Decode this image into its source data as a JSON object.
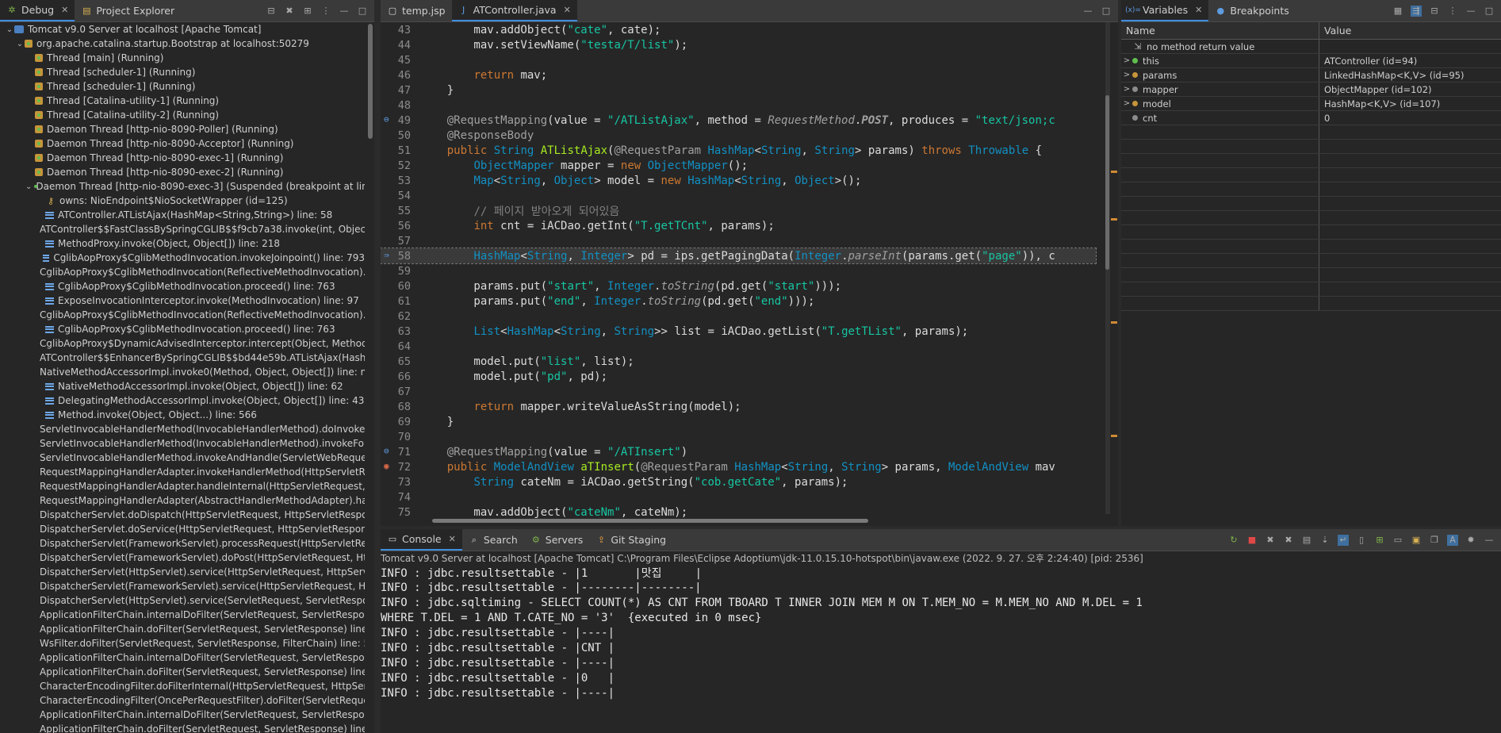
{
  "debug": {
    "tabs": [
      {
        "label": "Debug"
      },
      {
        "label": "Project Explorer"
      }
    ],
    "tree": [
      {
        "indent": 0,
        "tw": "⌄",
        "icon": "srv",
        "text": "Tomcat v9.0 Server at localhost [Apache Tomcat]"
      },
      {
        "indent": 1,
        "tw": "⌄",
        "icon": "thr",
        "text": "org.apache.catalina.startup.Bootstrap at localhost:50279"
      },
      {
        "indent": 2,
        "tw": "",
        "icon": "thr",
        "text": "Thread [main] (Running)"
      },
      {
        "indent": 2,
        "tw": "",
        "icon": "thr",
        "text": "Thread [scheduler-1] (Running)"
      },
      {
        "indent": 2,
        "tw": "",
        "icon": "thr",
        "text": "Thread [scheduler-1] (Running)"
      },
      {
        "indent": 2,
        "tw": "",
        "icon": "thr",
        "text": "Thread [Catalina-utility-1] (Running)"
      },
      {
        "indent": 2,
        "tw": "",
        "icon": "thr",
        "text": "Thread [Catalina-utility-2] (Running)"
      },
      {
        "indent": 2,
        "tw": "",
        "icon": "thr",
        "text": "Daemon Thread [http-nio-8090-Poller] (Running)"
      },
      {
        "indent": 2,
        "tw": "",
        "icon": "thr",
        "text": "Daemon Thread [http-nio-8090-Acceptor] (Running)"
      },
      {
        "indent": 2,
        "tw": "",
        "icon": "thr",
        "text": "Daemon Thread [http-nio-8090-exec-1] (Running)"
      },
      {
        "indent": 2,
        "tw": "",
        "icon": "thr",
        "text": "Daemon Thread [http-nio-8090-exec-2] (Running)"
      },
      {
        "indent": 2,
        "tw": "⌄",
        "icon": "thr",
        "text": "Daemon Thread [http-nio-8090-exec-3] (Suspended (breakpoint at line"
      },
      {
        "indent": 3,
        "tw": "",
        "icon": "key",
        "text": "owns: NioEndpoint$NioSocketWrapper  (id=125)"
      },
      {
        "indent": 3,
        "tw": "",
        "icon": "stk",
        "text": "ATController.ATListAjax(HashMap<String,String>) line: 58"
      },
      {
        "indent": 3,
        "tw": "",
        "icon": "stk",
        "text": "ATController$$FastClassBySpringCGLIB$$f9cb7a38.invoke(int, Object"
      },
      {
        "indent": 3,
        "tw": "",
        "icon": "stk",
        "text": "MethodProxy.invoke(Object, Object[]) line: 218"
      },
      {
        "indent": 3,
        "tw": "",
        "icon": "stk",
        "text": "CglibAopProxy$CglibMethodInvocation.invokeJoinpoint() line: 793"
      },
      {
        "indent": 3,
        "tw": "",
        "icon": "stk",
        "text": "CglibAopProxy$CglibMethodInvocation(ReflectiveMethodInvocation)."
      },
      {
        "indent": 3,
        "tw": "",
        "icon": "stk",
        "text": "CglibAopProxy$CglibMethodInvocation.proceed() line: 763"
      },
      {
        "indent": 3,
        "tw": "",
        "icon": "stk",
        "text": "ExposeInvocationInterceptor.invoke(MethodInvocation) line: 97"
      },
      {
        "indent": 3,
        "tw": "",
        "icon": "stk",
        "text": "CglibAopProxy$CglibMethodInvocation(ReflectiveMethodInvocation)."
      },
      {
        "indent": 3,
        "tw": "",
        "icon": "stk",
        "text": "CglibAopProxy$CglibMethodInvocation.proceed() line: 763"
      },
      {
        "indent": 3,
        "tw": "",
        "icon": "stk",
        "text": "CglibAopProxy$DynamicAdvisedInterceptor.intercept(Object, Method"
      },
      {
        "indent": 3,
        "tw": "",
        "icon": "stk",
        "text": "ATController$$EnhancerBySpringCGLIB$$bd44e59b.ATListAjax(HashM"
      },
      {
        "indent": 3,
        "tw": "",
        "icon": "stk",
        "text": "NativeMethodAccessorImpl.invoke0(Method, Object, Object[]) line: n"
      },
      {
        "indent": 3,
        "tw": "",
        "icon": "stk",
        "text": "NativeMethodAccessorImpl.invoke(Object, Object[]) line: 62"
      },
      {
        "indent": 3,
        "tw": "",
        "icon": "stk",
        "text": "DelegatingMethodAccessorImpl.invoke(Object, Object[]) line: 43"
      },
      {
        "indent": 3,
        "tw": "",
        "icon": "stk",
        "text": "Method.invoke(Object, Object...) line: 566"
      },
      {
        "indent": 3,
        "tw": "",
        "icon": "stk",
        "text": "ServletInvocableHandlerMethod(InvocableHandlerMethod).doInvoke("
      },
      {
        "indent": 3,
        "tw": "",
        "icon": "stk",
        "text": "ServletInvocableHandlerMethod(InvocableHandlerMethod).invokeForI"
      },
      {
        "indent": 3,
        "tw": "",
        "icon": "stk",
        "text": "ServletInvocableHandlerMethod.invokeAndHandle(ServletWebReques"
      },
      {
        "indent": 3,
        "tw": "",
        "icon": "stk",
        "text": "RequestMappingHandlerAdapter.invokeHandlerMethod(HttpServletRe"
      },
      {
        "indent": 3,
        "tw": "",
        "icon": "stk",
        "text": "RequestMappingHandlerAdapter.handleInternal(HttpServletRequest, H"
      },
      {
        "indent": 3,
        "tw": "",
        "icon": "stk",
        "text": "RequestMappingHandlerAdapter(AbstractHandlerMethodAdapter).har"
      },
      {
        "indent": 3,
        "tw": "",
        "icon": "stk",
        "text": "DispatcherServlet.doDispatch(HttpServletRequest, HttpServletRespon"
      },
      {
        "indent": 3,
        "tw": "",
        "icon": "stk",
        "text": "DispatcherServlet.doService(HttpServletRequest, HttpServletResponse"
      },
      {
        "indent": 3,
        "tw": "",
        "icon": "stk",
        "text": "DispatcherServlet(FrameworkServlet).processRequest(HttpServletRequ"
      },
      {
        "indent": 3,
        "tw": "",
        "icon": "stk",
        "text": "DispatcherServlet(FrameworkServlet).doPost(HttpServletRequest, Http"
      },
      {
        "indent": 3,
        "tw": "",
        "icon": "stk",
        "text": "DispatcherServlet(HttpServlet).service(HttpServletRequest, HttpServl"
      },
      {
        "indent": 3,
        "tw": "",
        "icon": "stk",
        "text": "DispatcherServlet(FrameworkServlet).service(HttpServletRequest, Http"
      },
      {
        "indent": 3,
        "tw": "",
        "icon": "stk",
        "text": "DispatcherServlet(HttpServlet).service(ServletRequest, ServletRespons"
      },
      {
        "indent": 3,
        "tw": "",
        "icon": "stk",
        "text": "ApplicationFilterChain.internalDoFilter(ServletRequest, ServletRespons"
      },
      {
        "indent": 3,
        "tw": "",
        "icon": "stk",
        "text": "ApplicationFilterChain.doFilter(ServletRequest, ServletResponse) line:"
      },
      {
        "indent": 3,
        "tw": "",
        "icon": "stk",
        "text": "WsFilter.doFilter(ServletRequest, ServletResponse, FilterChain) line: 53"
      },
      {
        "indent": 3,
        "tw": "",
        "icon": "stk",
        "text": "ApplicationFilterChain.internalDoFilter(ServletRequest, ServletRespons"
      },
      {
        "indent": 3,
        "tw": "",
        "icon": "stk",
        "text": "ApplicationFilterChain.doFilter(ServletRequest, ServletResponse) line:"
      },
      {
        "indent": 3,
        "tw": "",
        "icon": "stk",
        "text": "CharacterEncodingFilter.doFilterInternal(HttpServletRequest, HttpServl"
      },
      {
        "indent": 3,
        "tw": "",
        "icon": "stk",
        "text": "CharacterEncodingFilter(OncePerRequestFilter).doFilter(ServletReque"
      },
      {
        "indent": 3,
        "tw": "",
        "icon": "stk",
        "text": "ApplicationFilterChain.internalDoFilter(ServletRequest, ServletRespons"
      },
      {
        "indent": 3,
        "tw": "",
        "icon": "stk",
        "text": "ApplicationFilterChain.doFilter(ServletRequest, ServletResponse) line:"
      }
    ]
  },
  "editor": {
    "tabs": [
      {
        "label": "temp.jsp",
        "active": false
      },
      {
        "label": "ATController.java",
        "active": true
      }
    ],
    "lines": [
      {
        "n": "43",
        "html": "        mav.addObject(<span class=\"st\">\"cate\"</span>, cate);"
      },
      {
        "n": "44",
        "html": "        mav.setViewName(<span class=\"st\">\"testa/T/list\"</span>);"
      },
      {
        "n": "45",
        "html": ""
      },
      {
        "n": "46",
        "html": "        <span class=\"kw\">return</span> mav;"
      },
      {
        "n": "47",
        "html": "    }"
      },
      {
        "n": "48",
        "html": ""
      },
      {
        "n": "49",
        "mark": "⊖",
        "html": "    <span class=\"an\">@RequestMapping</span>(value = <span class=\"st\">\"/ATListAjax\"</span>, method = <span class=\"it\">RequestMethod</span>.<span class=\"it\"><b>POST</b></span>, produces = <span class=\"st\">\"text/json;c</span>"
      },
      {
        "n": "50",
        "html": "    <span class=\"an\">@ResponseBody</span>"
      },
      {
        "n": "51",
        "html": "    <span class=\"kw\">public</span> <span class=\"ty\">String</span> <span class=\"fn\">ATListAjax</span>(<span class=\"an\">@RequestParam</span> <span class=\"ty\">HashMap</span>&lt;<span class=\"ty\">String</span>, <span class=\"ty\">String</span>&gt; params) <span class=\"kw\">throws</span> <span class=\"ty\">Throwable</span> {"
      },
      {
        "n": "52",
        "html": "        <span class=\"ty\">ObjectMapper</span> mapper = <span class=\"kw\">new</span> <span class=\"ty\">ObjectMapper</span>();"
      },
      {
        "n": "53",
        "html": "        <span class=\"ty\">Map</span>&lt;<span class=\"ty\">String</span>, <span class=\"ty\">Object</span>&gt; model = <span class=\"kw\">new</span> <span class=\"ty\">HashMap</span>&lt;<span class=\"ty\">String</span>, <span class=\"ty\">Object</span>&gt;();"
      },
      {
        "n": "54",
        "html": ""
      },
      {
        "n": "55",
        "html": "        <span class=\"cm\">// 페이지 받아오게 되어있음</span>"
      },
      {
        "n": "56",
        "html": "        <span class=\"kw\">int</span> cnt = iACDao.getInt(<span class=\"st\">\"T.getTCnt\"</span>, params);"
      },
      {
        "n": "57",
        "html": ""
      },
      {
        "n": "58",
        "mark": "⇛",
        "hl": true,
        "html": "        <span class=\"ty\">HashMap</span>&lt;<span class=\"ty\">String</span>, <span class=\"ty\">Integer</span>&gt; pd = ips.getPagingData(<span class=\"ty\">Integer</span>.<span class=\"it\">parseInt</span>(params.get(<span class=\"st\">\"page\"</span>)), c"
      },
      {
        "n": "59",
        "html": ""
      },
      {
        "n": "60",
        "html": "        params.put(<span class=\"st\">\"start\"</span>, <span class=\"ty\">Integer</span>.<span class=\"it\">toString</span>(pd.get(<span class=\"st\">\"start\"</span>)));"
      },
      {
        "n": "61",
        "html": "        params.put(<span class=\"st\">\"end\"</span>, <span class=\"ty\">Integer</span>.<span class=\"it\">toString</span>(pd.get(<span class=\"st\">\"end\"</span>)));"
      },
      {
        "n": "62",
        "html": ""
      },
      {
        "n": "63",
        "html": "        <span class=\"ty\">List</span>&lt;<span class=\"ty\">HashMap</span>&lt;<span class=\"ty\">String</span>, <span class=\"ty\">String</span>&gt;&gt; list = iACDao.getList(<span class=\"st\">\"T.getTList\"</span>, params);"
      },
      {
        "n": "64",
        "html": ""
      },
      {
        "n": "65",
        "html": "        model.put(<span class=\"st\">\"list\"</span>, list);"
      },
      {
        "n": "66",
        "html": "        model.put(<span class=\"st\">\"pd\"</span>, pd);"
      },
      {
        "n": "67",
        "html": ""
      },
      {
        "n": "68",
        "html": "        <span class=\"kw\">return</span> mapper.writeValueAsString(model);"
      },
      {
        "n": "69",
        "html": "    }"
      },
      {
        "n": "70",
        "html": ""
      },
      {
        "n": "71",
        "mark": "⊖",
        "html": "    <span class=\"an\">@RequestMapping</span>(value = <span class=\"st\">\"/ATInsert\"</span>)"
      },
      {
        "n": "72",
        "mark": "◉",
        "br": true,
        "html": "    <span class=\"kw\">public</span> <span class=\"ty\">ModelAndView</span> <span class=\"fn\">aTInsert</span>(<span class=\"an\">@RequestParam</span> <span class=\"ty\">HashMap</span>&lt;<span class=\"ty\">String</span>, <span class=\"ty\">String</span>&gt; params, <span class=\"ty\">ModelAndView</span> mav"
      },
      {
        "n": "73",
        "html": "        <span class=\"ty\">String</span> cateNm = iACDao.getString(<span class=\"st\">\"cob.getCate\"</span>, params);"
      },
      {
        "n": "74",
        "html": ""
      },
      {
        "n": "75",
        "html": "        mav.addObject(<span class=\"st\">\"cateNm\"</span>, cateNm);"
      }
    ]
  },
  "vars": {
    "tabs": [
      {
        "label": "Variables"
      },
      {
        "label": "Breakpoints"
      }
    ],
    "headers": {
      "name": "Name",
      "value": "Value"
    },
    "rows": [
      {
        "tw": "",
        "icon": "ret",
        "name": "no method return value",
        "value": ""
      },
      {
        "tw": ">",
        "icon": "g",
        "name": "this",
        "value": "ATController  (id=94)"
      },
      {
        "tw": ">",
        "icon": "p",
        "name": "params",
        "value": "LinkedHashMap<K,V>  (id=95)"
      },
      {
        "tw": ">",
        "icon": "l",
        "name": "mapper",
        "value": "ObjectMapper  (id=102)"
      },
      {
        "tw": ">",
        "icon": "p",
        "name": "model",
        "value": "HashMap<K,V>  (id=107)"
      },
      {
        "tw": "",
        "icon": "l",
        "name": "cnt",
        "value": "0"
      },
      {
        "tw": "",
        "icon": "",
        "name": "",
        "value": ""
      },
      {
        "tw": "",
        "icon": "",
        "name": "",
        "value": ""
      },
      {
        "tw": "",
        "icon": "",
        "name": "",
        "value": ""
      },
      {
        "tw": "",
        "icon": "",
        "name": "",
        "value": ""
      },
      {
        "tw": "",
        "icon": "",
        "name": "",
        "value": ""
      },
      {
        "tw": "",
        "icon": "",
        "name": "",
        "value": ""
      },
      {
        "tw": "",
        "icon": "",
        "name": "",
        "value": ""
      },
      {
        "tw": "",
        "icon": "",
        "name": "",
        "value": ""
      },
      {
        "tw": "",
        "icon": "",
        "name": "",
        "value": ""
      },
      {
        "tw": "",
        "icon": "",
        "name": "",
        "value": ""
      },
      {
        "tw": "",
        "icon": "",
        "name": "",
        "value": ""
      },
      {
        "tw": "",
        "icon": "",
        "name": "",
        "value": ""
      },
      {
        "tw": "",
        "icon": "",
        "name": "",
        "value": ""
      }
    ]
  },
  "console": {
    "tabs": [
      {
        "label": "Console",
        "active": true
      },
      {
        "label": "Search",
        "active": false
      },
      {
        "label": "Servers",
        "active": false
      },
      {
        "label": "Git Staging",
        "active": false
      }
    ],
    "header": "Tomcat v9.0 Server at localhost [Apache Tomcat] C:\\Program Files\\Eclipse Adoptium\\jdk-11.0.15.10-hotspot\\bin\\javaw.exe  (2022. 9. 27. 오후 2:24:40) [pid: 2536]",
    "lines": [
      "INFO : jdbc.resultsettable - |1       |맛집     |",
      "INFO : jdbc.resultsettable - |--------|--------|",
      "INFO : jdbc.sqltiming - SELECT COUNT(*) AS CNT FROM TBOARD T INNER JOIN MEM M ON T.MEM_NO = M.MEM_NO AND M.DEL = 1",
      "WHERE T.DEL = 1 AND T.CATE_NO = '3'  {executed in 0 msec}",
      "INFO : jdbc.resultsettable - |----|",
      "INFO : jdbc.resultsettable - |CNT |",
      "INFO : jdbc.resultsettable - |----|",
      "INFO : jdbc.resultsettable - |0   |",
      "INFO : jdbc.resultsettable - |----|"
    ]
  },
  "colors": {
    "accent": "#3f8ee0",
    "breakpoint": "#e06c4a",
    "thread": "#c6953a"
  }
}
